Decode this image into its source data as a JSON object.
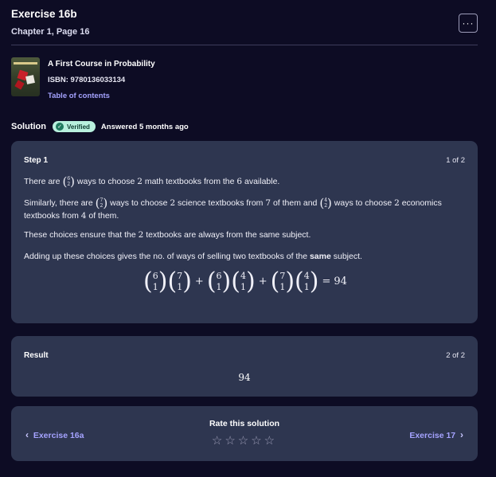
{
  "header": {
    "title": "Exercise 16b",
    "subtitle": "Chapter 1, Page 16",
    "more_label": "···",
    "more_icon": "ellipsis-icon"
  },
  "book": {
    "title": "A First Course in Probability",
    "isbn": "ISBN: 9780136033134",
    "toc": "Table of contents"
  },
  "solution": {
    "label": "Solution",
    "badge": "Verified",
    "badge_icon": "check-circle-icon",
    "answered": "Answered 5 months ago"
  },
  "step": {
    "title": "Step 1",
    "count": "1 of 2",
    "p1": {
      "a": "There are ",
      "n": "6",
      "k": "2",
      "b": " ways to choose ",
      "num1": "2",
      "c": " math textbooks from the ",
      "num2": "6",
      "d": " available."
    },
    "p2": {
      "a": "Similarly, there are ",
      "n1": "7",
      "k1": "2",
      "b": " ways to choose ",
      "num1": "2",
      "c": " science textbooks from ",
      "num2": "7",
      "d": " of them and ",
      "n2": "4",
      "k2": "2",
      "e": " ways to choose ",
      "num3": "2",
      "f": " economics textbooks from ",
      "num4": "4",
      "g": " of them."
    },
    "p3": {
      "a": "These choices ensure that the ",
      "num": "2",
      "b": " textbooks are always from the same subject."
    },
    "p4": {
      "a": "Adding up these choices gives the no. of ways of selling two textbooks of the ",
      "bold": "same",
      "b": " subject."
    },
    "formula": {
      "t1a": {
        "n": "6",
        "k": "1"
      },
      "t1b": {
        "n": "7",
        "k": "1"
      },
      "t2a": {
        "n": "6",
        "k": "1"
      },
      "t2b": {
        "n": "4",
        "k": "1"
      },
      "t3a": {
        "n": "7",
        "k": "1"
      },
      "t3b": {
        "n": "4",
        "k": "1"
      },
      "plus": "+",
      "eq": "=",
      "result": "94"
    }
  },
  "result": {
    "title": "Result",
    "count": "2 of 2",
    "value": "94"
  },
  "rating": {
    "label": "Rate this solution",
    "stars": "☆☆☆☆☆",
    "prev_label": "Exercise 16a",
    "prev_chevron": "‹",
    "next_label": "Exercise 17",
    "next_chevron": "›"
  }
}
